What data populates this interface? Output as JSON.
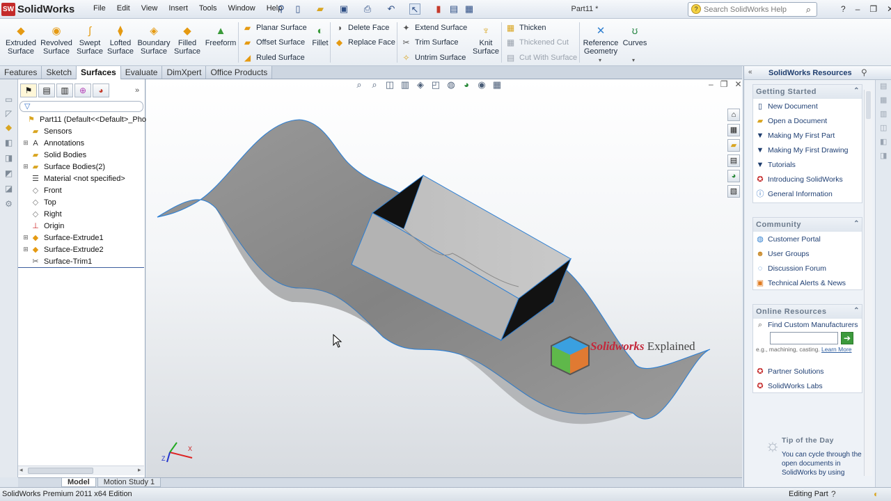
{
  "app": {
    "name": "SolidWorks",
    "logo_mark": "SW",
    "doc_title": "Part11 *"
  },
  "menus": [
    "File",
    "Edit",
    "View",
    "Insert",
    "Tools",
    "Window",
    "Help"
  ],
  "search": {
    "placeholder": "Search SolidWorks Help"
  },
  "command_manager": {
    "big_buttons": [
      {
        "label": "Extruded\nSurface",
        "icon": "extruded-surface-icon"
      },
      {
        "label": "Revolved\nSurface",
        "icon": "revolved-surface-icon"
      },
      {
        "label": "Swept\nSurface",
        "icon": "swept-surface-icon"
      },
      {
        "label": "Lofted\nSurface",
        "icon": "lofted-surface-icon"
      },
      {
        "label": "Boundary\nSurface",
        "icon": "boundary-surface-icon"
      },
      {
        "label": "Filled\nSurface",
        "icon": "filled-surface-icon"
      },
      {
        "label": "Freeform",
        "icon": "freeform-icon"
      }
    ],
    "group1": [
      "Planar Surface",
      "Offset Surface",
      "Ruled Surface"
    ],
    "fillet": "Fillet",
    "group2": [
      "Delete Face",
      "Replace Face"
    ],
    "group3": [
      "Extend Surface",
      "Trim Surface",
      "Untrim Surface"
    ],
    "knit": "Knit\nSurface",
    "group4": [
      "Thicken",
      "Thickened Cut",
      "Cut With Surface"
    ],
    "reference_geometry": "Reference\nGeometry",
    "curves": "Curves"
  },
  "tabs": [
    "Features",
    "Sketch",
    "Surfaces",
    "Evaluate",
    "DimXpert",
    "Office Products"
  ],
  "active_tab": "Surfaces",
  "feature_tree": [
    {
      "label": "Part11  (Default<<Default>_Pho",
      "icon": "part-icon",
      "expander": ""
    },
    {
      "label": "Sensors",
      "icon": "sensors-icon",
      "expander": ""
    },
    {
      "label": "Annotations",
      "icon": "annotations-icon",
      "expander": "+"
    },
    {
      "label": "Solid Bodies",
      "icon": "solid-bodies-icon",
      "expander": ""
    },
    {
      "label": "Surface Bodies(2)",
      "icon": "surface-bodies-icon",
      "expander": "+"
    },
    {
      "label": "Material <not specified>",
      "icon": "material-icon",
      "expander": ""
    },
    {
      "label": "Front",
      "icon": "plane-icon",
      "expander": ""
    },
    {
      "label": "Top",
      "icon": "plane-icon",
      "expander": ""
    },
    {
      "label": "Right",
      "icon": "plane-icon",
      "expander": ""
    },
    {
      "label": "Origin",
      "icon": "origin-icon",
      "expander": ""
    },
    {
      "label": "Surface-Extrude1",
      "icon": "surface-extrude-icon",
      "expander": "+"
    },
    {
      "label": "Surface-Extrude2",
      "icon": "surface-extrude-icon",
      "expander": "+"
    },
    {
      "label": "Surface-Trim1",
      "icon": "surface-trim-icon",
      "expander": ""
    }
  ],
  "bottom_tabs": [
    "Model",
    "Motion Study 1"
  ],
  "status": {
    "left": "SolidWorks Premium 2011 x64 Edition",
    "right": "Editing Part"
  },
  "resources": {
    "title": "SolidWorks Resources",
    "sections": [
      {
        "title": "Getting Started",
        "links": [
          "New Document",
          "Open a Document",
          "Making My First Part",
          "Making My First Drawing",
          "Tutorials",
          "Introducing SolidWorks",
          "General Information"
        ]
      },
      {
        "title": "Community",
        "links": [
          "Customer Portal",
          "User Groups",
          "Discussion Forum",
          "Technical Alerts & News"
        ]
      },
      {
        "title": "Online Resources",
        "links": [
          "Partner Solutions",
          "SolidWorks Labs"
        ]
      }
    ],
    "find_label": "Find Custom Manufacturers",
    "find_hint": "e.g., machining, casting.",
    "learn_more": "Learn More",
    "tip_title": "Tip of the Day",
    "tip_text": "You can cycle through the open documents in SolidWorks by using"
  },
  "watermark": {
    "brand": "Solidworks",
    "suffix": "Explained"
  },
  "triad": {
    "x": "X",
    "z": "Z"
  },
  "colors": {
    "accent": "#1e3d6e",
    "surface": "#8c8c8c",
    "edge": "#3f8fd6"
  }
}
